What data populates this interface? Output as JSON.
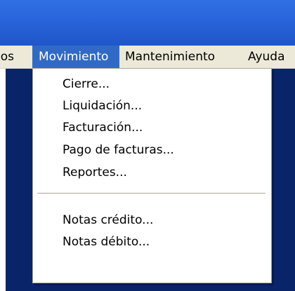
{
  "menubar": {
    "items": [
      {
        "label": "ios"
      },
      {
        "label": "Movimiento"
      },
      {
        "label": "Mantenimiento"
      },
      {
        "label": "Ayuda"
      }
    ]
  },
  "movimiento_menu": {
    "group1": [
      {
        "label": "Cierre..."
      },
      {
        "label": "Liquidación..."
      },
      {
        "label": "Facturación..."
      },
      {
        "label": "Pago de facturas..."
      },
      {
        "label": "Reportes..."
      }
    ],
    "group2": [
      {
        "label": "Notas crédito..."
      },
      {
        "label": "Notas débito..."
      }
    ]
  },
  "colors": {
    "titlebar": "#2a64da",
    "menu_highlight": "#316ac5",
    "client_background": "#0a246a",
    "menubar_background": "#ece9d8"
  }
}
